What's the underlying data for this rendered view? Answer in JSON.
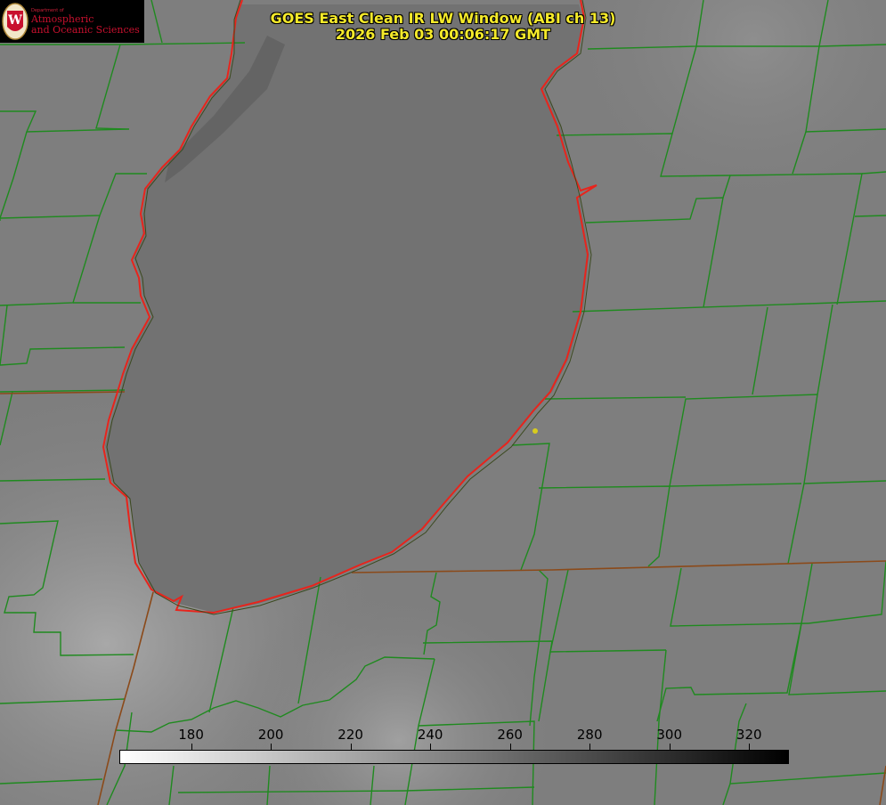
{
  "title": {
    "line1": "GOES East Clean IR LW Window (ABI ch 13)",
    "line2": "2026 Feb 03 00:06:17 GMT"
  },
  "logo": {
    "dept": "Department of",
    "line1": "Atmospheric",
    "line2": "and Oceanic Sciences",
    "seal_letter": "W"
  },
  "colorbar": {
    "units_range": [
      162,
      330
    ],
    "ticks": [
      "180",
      "200",
      "220",
      "240",
      "260",
      "280",
      "300",
      "320"
    ],
    "tick_values": [
      180,
      200,
      220,
      240,
      260,
      280,
      300,
      320
    ],
    "gradient_from": "#ffffff",
    "gradient_to": "#000000"
  },
  "colors": {
    "county_lines": "#1f8a1f",
    "shoreline": "#e8241c",
    "state_lines": "#8b4a1a",
    "marker": "#d8cc1e",
    "title_text": "#f5ea2a"
  }
}
